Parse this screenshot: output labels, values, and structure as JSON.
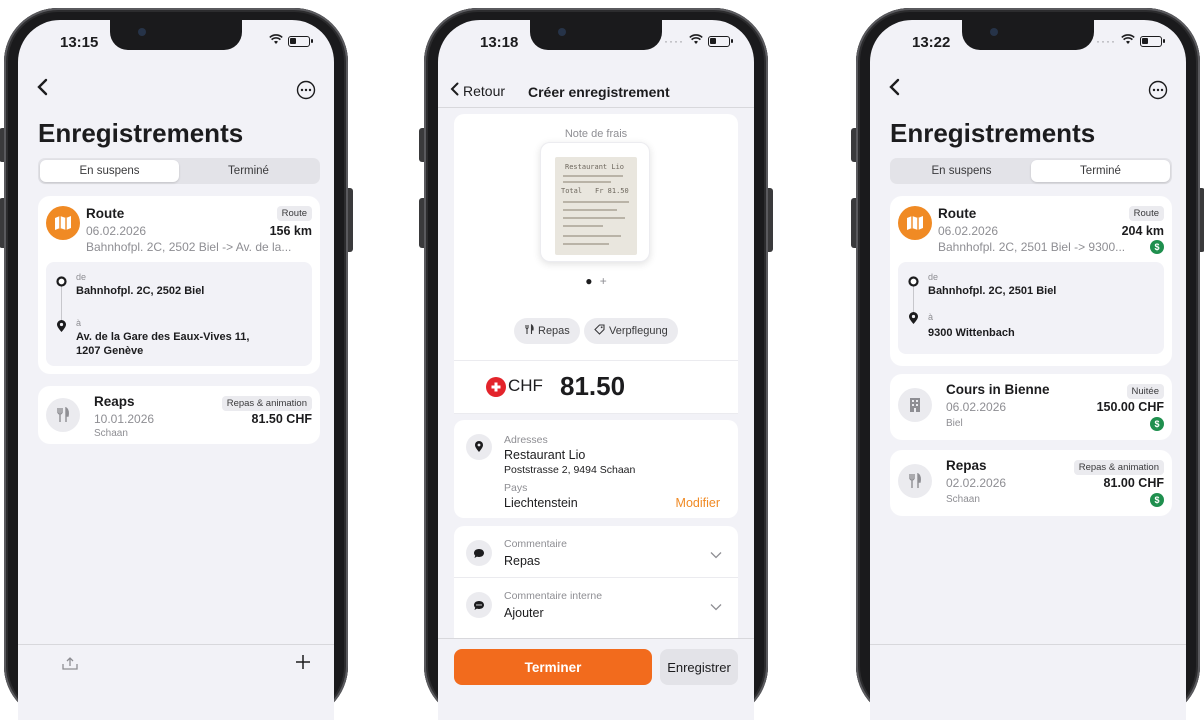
{
  "phone1": {
    "time": "13:15",
    "title": "Enregistrements",
    "tabs": [
      "En suspens",
      "Terminé"
    ],
    "route_card": {
      "title": "Route",
      "date": "06.02.2026",
      "badge": "Route",
      "value": "156 km",
      "summary": "Bahnhofpl. 2C, 2502 Biel -> Av. de la...",
      "from_label": "de",
      "from": "Bahnhofpl. 2C, 2502 Biel",
      "to_label": "à",
      "to_line1": "Av. de la Gare des Eaux-Vives 11,",
      "to_line2": "1207 Genève"
    },
    "meal_card": {
      "title": "Reaps",
      "date": "10.01.2026",
      "place": "Schaan",
      "badge": "Repas & animation",
      "value": "81.50 CHF"
    },
    "icons": {
      "back": "chevron-left-icon",
      "more": "ellipsis-circle-icon",
      "export": "tray-upload-icon",
      "add": "plus-icon"
    }
  },
  "phone2": {
    "time": "13:18",
    "back_label": "Retour",
    "title": "Créer enregistrement",
    "note_label": "Note de frais",
    "receipt": {
      "line1": "Restaurant Lio",
      "total_label": "Total",
      "total": "Fr 81.50"
    },
    "chips": [
      "Repas",
      "Verpflegung"
    ],
    "currency": "CHF",
    "amount": "81.50",
    "address_label": "Adresses",
    "address_name": "Restaurant Lio",
    "address_street": "Poststrasse 2, 9494 Schaan",
    "country_label": "Pays",
    "country": "Liechtenstein",
    "modify": "Modifier",
    "comment_label": "Commentaire",
    "comment": "Repas",
    "internal_label": "Commentaire interne",
    "internal": "Ajouter",
    "btn_finish": "Terminer",
    "btn_save": "Enregistrer"
  },
  "phone3": {
    "time": "13:22",
    "title": "Enregistrements",
    "tabs": [
      "En suspens",
      "Terminé"
    ],
    "route_card": {
      "title": "Route",
      "date": "06.02.2026",
      "badge": "Route",
      "value": "204 km",
      "summary": "Bahnhofpl. 2C, 2501 Biel -> 9300...",
      "from_label": "de",
      "from": "Bahnhofpl. 2C, 2501 Biel",
      "to_label": "à",
      "to": "9300 Wittenbach"
    },
    "course_card": {
      "title": "Cours in Bienne",
      "date": "06.02.2026",
      "place": "Biel",
      "badge": "Nuitée",
      "value": "150.00 CHF"
    },
    "meal_card": {
      "title": "Repas",
      "date": "02.02.2026",
      "place": "Schaan",
      "badge": "Repas & animation",
      "value": "81.00 CHF"
    },
    "paid_symbol": "$"
  },
  "colors": {
    "accent": "#f08a24",
    "primary_button": "#f26b1d",
    "paid": "#1f8f4e",
    "swiss_red": "#e3242b"
  }
}
